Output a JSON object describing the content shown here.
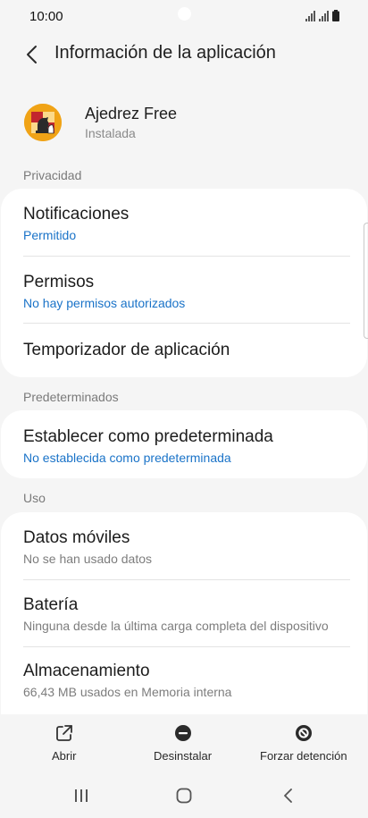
{
  "status_bar": {
    "time": "10:00"
  },
  "app_bar": {
    "title": "Información de la aplicación"
  },
  "app": {
    "name": "Ajedrez Free",
    "status": "Instalada"
  },
  "sections": {
    "privacy": {
      "label": "Privacidad",
      "items": [
        {
          "title": "Notificaciones",
          "subtitle": "Permitido"
        },
        {
          "title": "Permisos",
          "subtitle": "No hay permisos autorizados"
        },
        {
          "title": "Temporizador de aplicación"
        }
      ]
    },
    "defaults": {
      "label": "Predeterminados",
      "items": [
        {
          "title": "Establecer como predeterminada",
          "subtitle": "No establecida como predeterminada"
        }
      ]
    },
    "usage": {
      "label": "Uso",
      "items": [
        {
          "title": "Datos móviles",
          "subtitle": "No se han usado datos"
        },
        {
          "title": "Batería",
          "subtitle": "Ninguna desde la última carga completa del dispositivo"
        },
        {
          "title": "Almacenamiento",
          "subtitle": "66,43 MB usados en Memoria interna"
        }
      ]
    }
  },
  "actions": {
    "open": "Abrir",
    "uninstall": "Desinstalar",
    "force_stop": "Forzar detención"
  },
  "colors": {
    "accent": "#1a73c8",
    "background": "#f5f5f5",
    "card": "#ffffff"
  },
  "icons": {
    "back": "chevron-left-icon",
    "open": "open-external-icon",
    "uninstall": "minus-circle-icon",
    "force_stop": "block-icon",
    "nav_recents": "recents-icon",
    "nav_home": "home-icon",
    "nav_back": "back-icon"
  }
}
